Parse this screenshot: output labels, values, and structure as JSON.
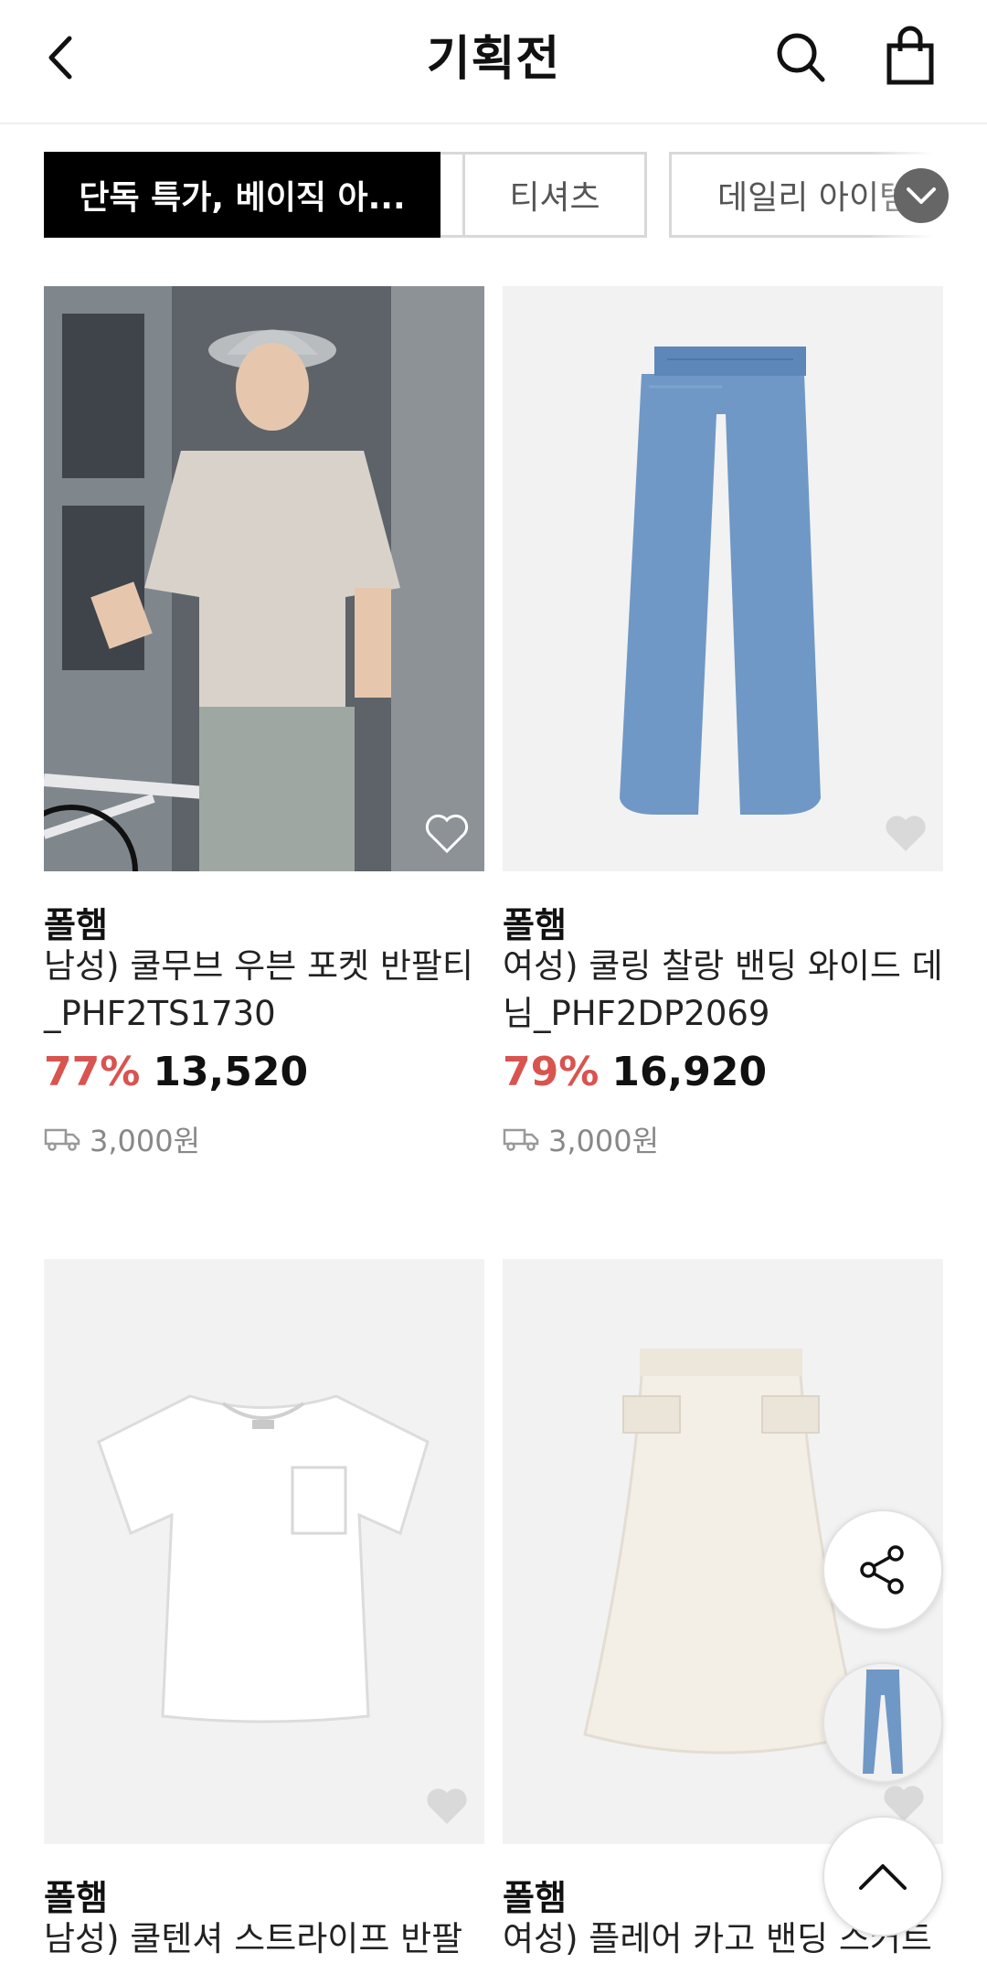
{
  "header": {
    "title": "기획전"
  },
  "tabs": [
    {
      "label": "단독 특가, 베이직 아...",
      "active": true
    },
    {
      "label": "티셔츠",
      "active": false
    },
    {
      "label": "데일리 아이템",
      "active": false
    }
  ],
  "products": [
    {
      "brand": "폴햄",
      "name": "남성) 쿨무브 우븐 포켓 반팔티_PHF2TS1730",
      "discount": "77%",
      "price": "13,520",
      "shipping": "3,000원",
      "image": "man-in-hat-with-bicycle"
    },
    {
      "brand": "폴햄",
      "name": "여성) 쿨링 찰랑 밴딩 와이드 데님_PHF2DP2069",
      "discount": "79%",
      "price": "16,920",
      "shipping": "3,000원",
      "image": "blue-wide-denim-pants"
    },
    {
      "brand": "폴햄",
      "name": "남성) 쿨텐셔 스트라이프 반팔",
      "image": "white-pocket-tshirt"
    },
    {
      "brand": "폴햄",
      "name": "여성) 플레어 카고 밴딩 스커트",
      "image": "cream-cargo-skirt"
    }
  ],
  "colors": {
    "accent_discount": "#d9534f",
    "active_tab_bg": "#000000",
    "shipping_text": "#888888"
  },
  "icons": [
    "back-arrow-icon",
    "search-icon",
    "shopping-bag-icon",
    "chevron-down-icon",
    "heart-icon",
    "truck-icon",
    "share-icon",
    "chevron-up-icon"
  ]
}
